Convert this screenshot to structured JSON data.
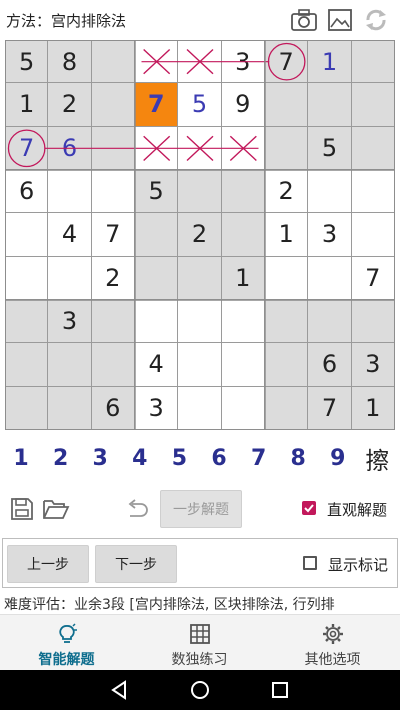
{
  "header": {
    "method_title": "方法：宫内排除法",
    "icons": [
      "camera-icon",
      "image-icon",
      "refresh-icon"
    ]
  },
  "board": {
    "rows": [
      [
        {
          "v": "5",
          "t": "g"
        },
        {
          "v": "8",
          "t": "g"
        },
        {
          "v": "",
          "t": ""
        },
        {
          "v": "",
          "t": "x"
        },
        {
          "v": "",
          "t": "x"
        },
        {
          "v": "3",
          "t": "g"
        },
        {
          "v": "7",
          "t": "g"
        },
        {
          "v": "1",
          "t": "s"
        },
        {
          "v": "",
          "t": ""
        }
      ],
      [
        {
          "v": "1",
          "t": "g"
        },
        {
          "v": "2",
          "t": "g"
        },
        {
          "v": "",
          "t": ""
        },
        {
          "v": "7",
          "t": "h"
        },
        {
          "v": "5",
          "t": "s"
        },
        {
          "v": "9",
          "t": "g"
        },
        {
          "v": "",
          "t": ""
        },
        {
          "v": "",
          "t": ""
        },
        {
          "v": "",
          "t": ""
        }
      ],
      [
        {
          "v": "7",
          "t": "s"
        },
        {
          "v": "6",
          "t": "s"
        },
        {
          "v": "",
          "t": ""
        },
        {
          "v": "",
          "t": "x"
        },
        {
          "v": "",
          "t": "x"
        },
        {
          "v": "",
          "t": "x"
        },
        {
          "v": "",
          "t": ""
        },
        {
          "v": "5",
          "t": "g"
        },
        {
          "v": "",
          "t": ""
        }
      ],
      [
        {
          "v": "6",
          "t": "g"
        },
        {
          "v": "",
          "t": ""
        },
        {
          "v": "",
          "t": ""
        },
        {
          "v": "5",
          "t": "g"
        },
        {
          "v": "",
          "t": ""
        },
        {
          "v": "",
          "t": ""
        },
        {
          "v": "2",
          "t": "g"
        },
        {
          "v": "",
          "t": ""
        },
        {
          "v": "",
          "t": ""
        }
      ],
      [
        {
          "v": "",
          "t": ""
        },
        {
          "v": "4",
          "t": "g"
        },
        {
          "v": "7",
          "t": "g"
        },
        {
          "v": "",
          "t": ""
        },
        {
          "v": "2",
          "t": "g"
        },
        {
          "v": "",
          "t": ""
        },
        {
          "v": "1",
          "t": "g"
        },
        {
          "v": "3",
          "t": "g"
        },
        {
          "v": "",
          "t": ""
        }
      ],
      [
        {
          "v": "",
          "t": ""
        },
        {
          "v": "",
          "t": ""
        },
        {
          "v": "2",
          "t": "g"
        },
        {
          "v": "",
          "t": ""
        },
        {
          "v": "",
          "t": ""
        },
        {
          "v": "1",
          "t": "g"
        },
        {
          "v": "",
          "t": ""
        },
        {
          "v": "",
          "t": ""
        },
        {
          "v": "7",
          "t": "g"
        }
      ],
      [
        {
          "v": "",
          "t": ""
        },
        {
          "v": "3",
          "t": "g"
        },
        {
          "v": "",
          "t": ""
        },
        {
          "v": "",
          "t": ""
        },
        {
          "v": "",
          "t": ""
        },
        {
          "v": "",
          "t": ""
        },
        {
          "v": "",
          "t": ""
        },
        {
          "v": "",
          "t": ""
        },
        {
          "v": "",
          "t": ""
        }
      ],
      [
        {
          "v": "",
          "t": ""
        },
        {
          "v": "",
          "t": ""
        },
        {
          "v": "",
          "t": ""
        },
        {
          "v": "4",
          "t": "g"
        },
        {
          "v": "",
          "t": ""
        },
        {
          "v": "",
          "t": ""
        },
        {
          "v": "",
          "t": ""
        },
        {
          "v": "6",
          "t": "g"
        },
        {
          "v": "3",
          "t": "g"
        }
      ],
      [
        {
          "v": "",
          "t": ""
        },
        {
          "v": "",
          "t": ""
        },
        {
          "v": "6",
          "t": "g"
        },
        {
          "v": "3",
          "t": "g"
        },
        {
          "v": "",
          "t": ""
        },
        {
          "v": "",
          "t": ""
        },
        {
          "v": "",
          "t": ""
        },
        {
          "v": "7",
          "t": "g"
        },
        {
          "v": "1",
          "t": "g"
        }
      ]
    ],
    "colors": {
      "gray_box": "#dcdcdc",
      "white_box": "#ffffff",
      "highlight": "#f5860f",
      "given_digit": "#222222",
      "solved_digit": "#3b3bb3",
      "mark_line": "#c2185b",
      "grid_line": "#9a9a9a"
    }
  },
  "numpad": {
    "digits": [
      "1",
      "2",
      "3",
      "4",
      "5",
      "6",
      "7",
      "8",
      "9"
    ],
    "erase_label": "擦"
  },
  "toolbar": {
    "save_icon": "save-icon",
    "open_icon": "folder-open-icon",
    "undo_icon": "undo-icon",
    "step_solve_label": "一步解题",
    "intuitive_label": "直观解题",
    "intuitive_checked": true
  },
  "step_panel": {
    "prev_label": "上一步",
    "next_label": "下一步",
    "show_marks_label": "显示标记",
    "show_marks_checked": false
  },
  "difficulty_text": "难度评估：业余3段 [宫内排除法, 区块排除法, 行列排",
  "tabs": [
    {
      "label": "智能解题",
      "icon": "lightbulb-icon",
      "active": true
    },
    {
      "label": "数独练习",
      "icon": "grid-icon",
      "active": false
    },
    {
      "label": "其他选项",
      "icon": "gear-icon",
      "active": false
    }
  ],
  "accent_color": "#0f6e8e",
  "checkbox_color": "#c2185b"
}
